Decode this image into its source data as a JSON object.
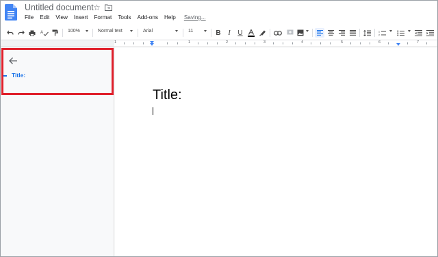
{
  "app": {
    "doc_title": "Untitled document",
    "menu": [
      "File",
      "Edit",
      "View",
      "Insert",
      "Format",
      "Tools",
      "Add-ons",
      "Help"
    ],
    "save_status": "Saving..."
  },
  "toolbar": {
    "zoom": "100%",
    "style": "Normal text",
    "font": "Arial",
    "font_size": "11"
  },
  "ruler": {
    "labels": [
      "1",
      "1",
      "2",
      "3",
      "4",
      "5",
      "6",
      "7"
    ]
  },
  "outline": {
    "items": [
      "Title:"
    ]
  },
  "document": {
    "heading": "Title:"
  },
  "colors": {
    "accent": "#1a73e8",
    "highlight_border": "#e0202b",
    "doc_icon": "#4285f4"
  }
}
